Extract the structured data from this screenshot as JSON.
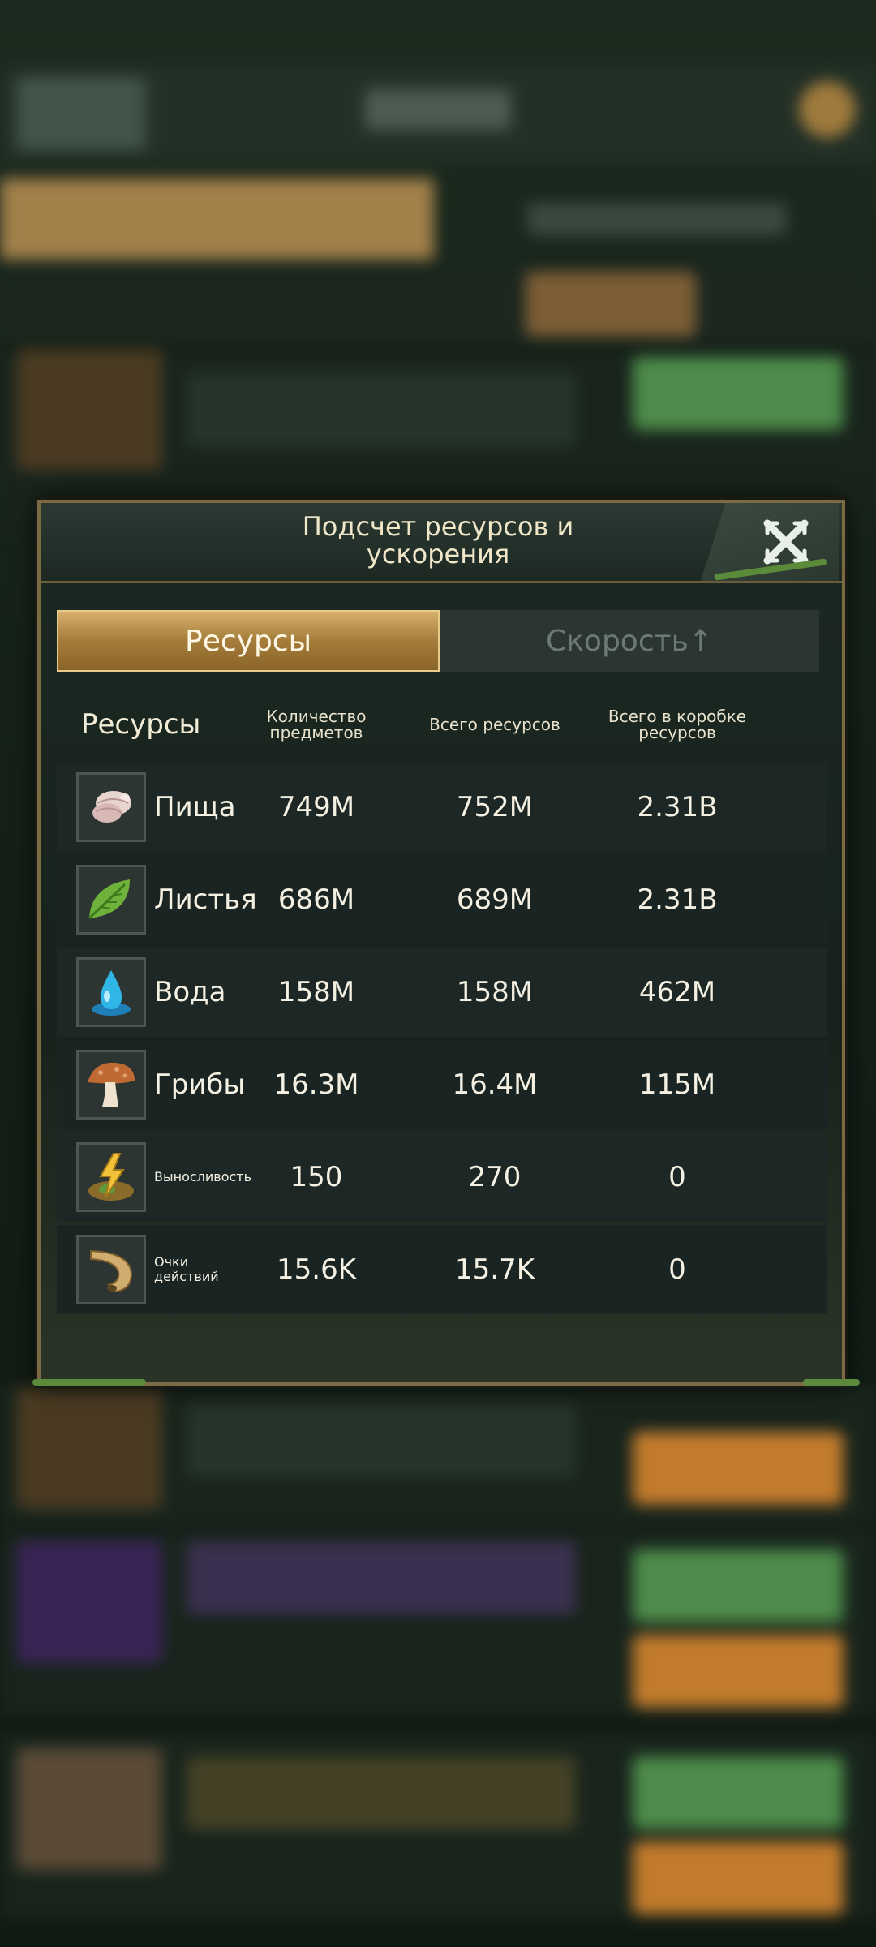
{
  "dialog": {
    "title": "Подсчет ресурсов и\nускорения",
    "close_icon": "close-x-icon"
  },
  "tabs": [
    {
      "label": "Ресурсы",
      "active": true
    },
    {
      "label": "Скорость↑",
      "active": false
    }
  ],
  "columns": {
    "resources": "Ресурсы",
    "item_count": "Количество\nпредметов",
    "total_resources": "Всего ресурсов",
    "total_in_box": "Всего в коробке\nресурсов"
  },
  "rows": [
    {
      "name": "Пища",
      "icon": "food-larva-icon",
      "item_count": "749M",
      "total": "752M",
      "box_total": "2.31B"
    },
    {
      "name": "Листья",
      "icon": "leaf-icon",
      "item_count": "686M",
      "total": "689M",
      "box_total": "2.31B"
    },
    {
      "name": "Вода",
      "icon": "water-drop-icon",
      "item_count": "158M",
      "total": "158M",
      "box_total": "462M"
    },
    {
      "name": "Грибы",
      "icon": "mushroom-icon",
      "item_count": "16.3M",
      "total": "16.4M",
      "box_total": "115M"
    },
    {
      "name": "Выносливость",
      "icon": "stamina-lightning-icon",
      "item_count": "150",
      "total": "270",
      "box_total": "0"
    },
    {
      "name": "Очки\nдействий",
      "icon": "horn-icon",
      "item_count": "15.6K",
      "total": "15.7K",
      "box_total": "0"
    }
  ],
  "colors": {
    "accent_gold": "#a57c3a",
    "panel_bg": "#17221c"
  }
}
